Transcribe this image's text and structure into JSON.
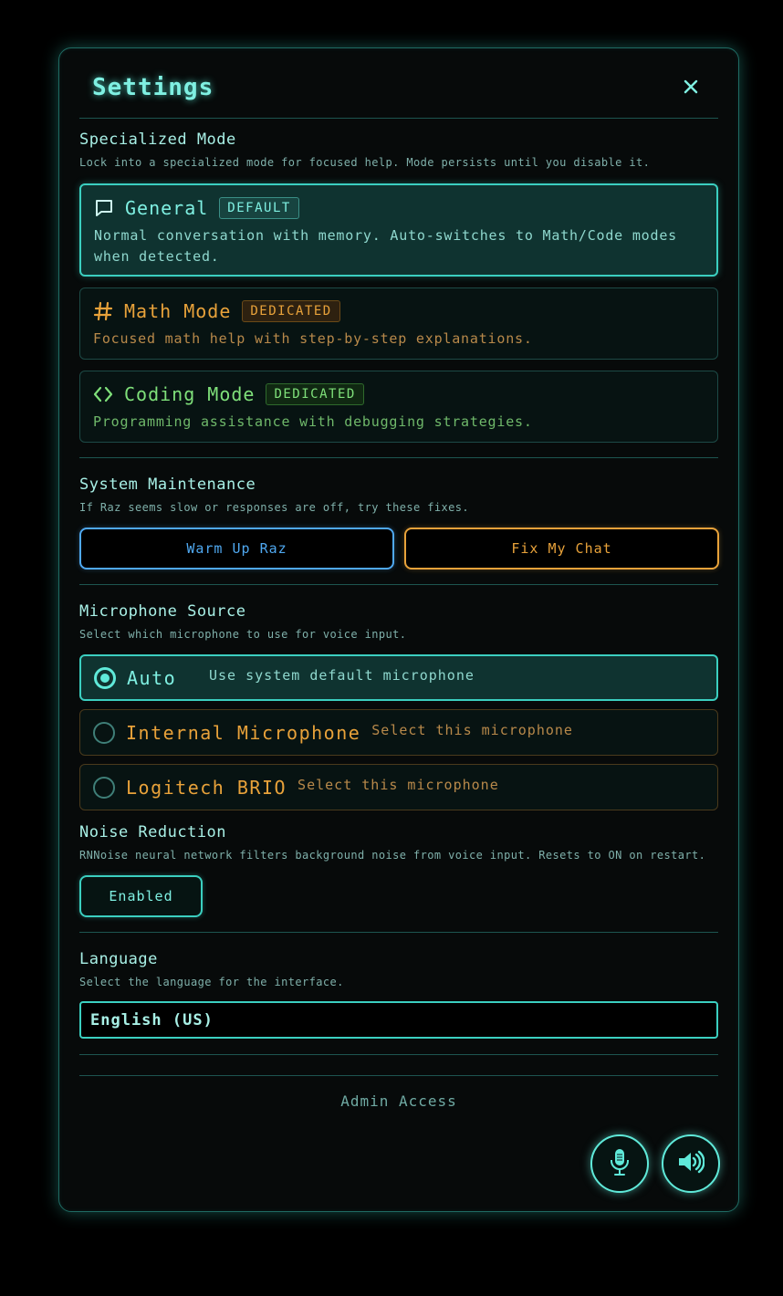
{
  "header": {
    "title": "Settings"
  },
  "specialized_mode": {
    "title": "Specialized Mode",
    "description": "Lock into a specialized mode for focused help. Mode persists until you disable it.",
    "modes": [
      {
        "name": "General",
        "badge": "DEFAULT",
        "description": "Normal conversation with memory. Auto-switches to Math/Code modes when detected.",
        "icon": "chat-bubble-icon",
        "selected": true
      },
      {
        "name": "Math Mode",
        "badge": "DEDICATED",
        "description": "Focused math help with step-by-step explanations.",
        "icon": "hash-icon",
        "selected": false
      },
      {
        "name": "Coding Mode",
        "badge": "DEDICATED",
        "description": "Programming assistance with debugging strategies.",
        "icon": "code-icon",
        "selected": false
      }
    ]
  },
  "system_maintenance": {
    "title": "System Maintenance",
    "description": "If Raz seems slow or responses are off, try these fixes.",
    "warm_up_label": "Warm Up Raz",
    "fix_chat_label": "Fix My Chat"
  },
  "microphone": {
    "title": "Microphone Source",
    "description": "Select which microphone to use for voice input.",
    "options": [
      {
        "name": "Auto",
        "description": "Use system default microphone",
        "selected": true
      },
      {
        "name": "Internal Microphone",
        "description": "Select this microphone",
        "selected": false
      },
      {
        "name": "Logitech BRIO",
        "description": "Select this microphone",
        "selected": false
      }
    ]
  },
  "noise_reduction": {
    "title": "Noise Reduction",
    "description": "RNNoise neural network filters background noise from voice input. Resets to ON on restart.",
    "toggle_label": "Enabled"
  },
  "language": {
    "title": "Language",
    "description": "Select the language for the interface.",
    "selected": "English (US)"
  },
  "footer": {
    "admin_label": "Admin Access"
  },
  "colors": {
    "accent": "#5fe9d9",
    "general": "#7ff0e2",
    "math": "#e8a23a",
    "coding": "#7fe07a",
    "warm_up": "#4fa8f0",
    "fix_chat": "#e8a23a"
  }
}
